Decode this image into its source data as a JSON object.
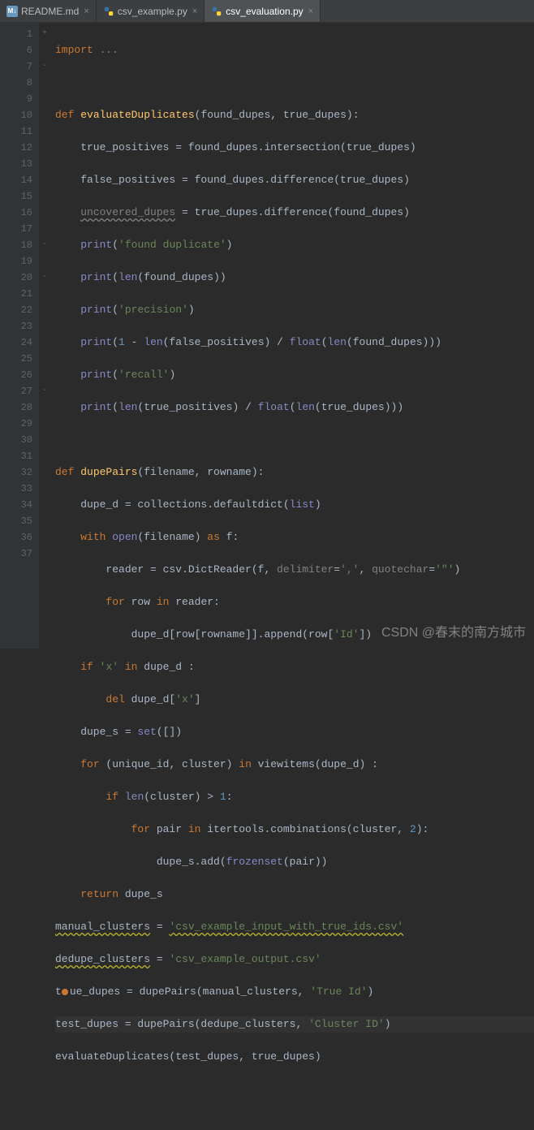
{
  "tabs": [
    {
      "label": "README.md",
      "type": "md",
      "active": false
    },
    {
      "label": "csv_example.py",
      "type": "py",
      "active": false
    },
    {
      "label": "csv_evaluation.py",
      "type": "py",
      "active": true
    }
  ],
  "line_numbers": [
    "1",
    "6",
    "7",
    "8",
    "9",
    "10",
    "11",
    "12",
    "13",
    "14",
    "15",
    "16",
    "17",
    "18",
    "19",
    "20",
    "21",
    "22",
    "23",
    "24",
    "25",
    "26",
    "27",
    "28",
    "29",
    "30",
    "31",
    "32",
    "33",
    "34",
    "35",
    "36",
    "37",
    ""
  ],
  "fold_marks": [
    "+",
    "",
    "-",
    "",
    "",
    "",
    "",
    "",
    "",
    "",
    "",
    "",
    "",
    "-",
    "",
    "-",
    "",
    "",
    "",
    "",
    "",
    "",
    "-",
    "",
    "",
    "",
    "",
    "",
    "",
    "",
    "",
    "",
    "",
    ""
  ],
  "code": {
    "l1": {
      "kw": "import",
      "rest": " ..."
    },
    "l7": {
      "def": "def ",
      "name": "evaluateDuplicates",
      "params": "(found_dupes, true_dupes):"
    },
    "l8": "    true_positives = found_dupes.intersection(true_dupes)",
    "l9": "    false_positives = found_dupes.difference(true_dupes)",
    "l10": {
      "lhs": "    ",
      "var": "uncovered_dupes",
      "rhs": " = true_dupes.difference(found_dupes)"
    },
    "l11": {
      "pre": "    ",
      "fn": "print",
      "open": "(",
      "str": "'found duplicate'",
      "close": ")"
    },
    "l12": {
      "pre": "    ",
      "fn": "print",
      "open": "(",
      "bi": "len",
      "args": "(found_dupes))"
    },
    "l13": {
      "pre": "    ",
      "fn": "print",
      "open": "(",
      "str": "'precision'",
      "close": ")"
    },
    "l14": {
      "pre": "    ",
      "fn": "print",
      "open": "(",
      "one": "1",
      "mid1": " - ",
      "bi1": "len",
      "a1": "(false_positives) / ",
      "bi2": "float",
      "a2": "(",
      "bi3": "len",
      "a3": "(found_dupes)))"
    },
    "l15": {
      "pre": "    ",
      "fn": "print",
      "open": "(",
      "str": "'recall'",
      "close": ")"
    },
    "l16": {
      "pre": "    ",
      "fn": "print",
      "open": "(",
      "bi1": "len",
      "a1": "(true_positives) / ",
      "bi2": "float",
      "a2": "(",
      "bi3": "len",
      "a3": "(true_dupes)))"
    },
    "l18": {
      "def": "def ",
      "name": "dupePairs",
      "params": "(filename, rowname):"
    },
    "l19": {
      "pre": "    dupe_d = collections.defaultdict(",
      "bi": "list",
      "post": ")"
    },
    "l20": {
      "pre": "    ",
      "kw1": "with",
      "mid": " ",
      "bi": "open",
      "args": "(filename) ",
      "kw2": "as",
      "post": " f:"
    },
    "l21": {
      "pre": "        reader = csv.DictReader(f, ",
      "p1": "delimiter",
      "e1": "=",
      "s1": "','",
      "c": ", ",
      "p2": "quotechar",
      "e2": "=",
      "s2": "'\"'",
      "end": ")"
    },
    "l22": {
      "pre": "        ",
      "kw1": "for",
      "m1": " row ",
      "kw2": "in",
      "post": " reader:"
    },
    "l23": {
      "pre": "            dupe_d[row[rowname]].append(row[",
      "str": "'Id'",
      "post": "])"
    },
    "l24": {
      "pre": "    ",
      "kw1": "if",
      "m1": " ",
      "str": "'x'",
      "m2": " ",
      "kw2": "in",
      "post": " dupe_d :"
    },
    "l25": {
      "pre": "        ",
      "kw": "del",
      "mid": " dupe_d[",
      "str": "'x'",
      "post": "]"
    },
    "l26": {
      "pre": "    dupe_s = ",
      "bi": "set",
      "post": "([])"
    },
    "l27": {
      "pre": "    ",
      "kw1": "for",
      "m1": " (unique_id, cluster) ",
      "kw2": "in",
      "m2": " viewitems(dupe_d) :"
    },
    "l28": {
      "pre": "        ",
      "kw": "if",
      "m1": " ",
      "bi": "len",
      "args": "(cluster) > ",
      "num": "1",
      "post": ":"
    },
    "l29": {
      "pre": "            ",
      "kw1": "for",
      "m1": " pair ",
      "kw2": "in",
      "m2": " itertools.combinations(cluster, ",
      "num": "2",
      "post": "):"
    },
    "l30": {
      "pre": "                dupe_s.add(",
      "bi": "frozenset",
      "post": "(pair))"
    },
    "l31": {
      "pre": "    ",
      "kw": "return",
      "post": " dupe_s"
    },
    "l32": {
      "var": "manual_clusters",
      "eq": " = ",
      "str": "'csv_example_input_with_true_ids.csv'"
    },
    "l33": {
      "var": "dedupe_clusters",
      "eq": " = ",
      "str": "'csv_example_output.csv'"
    },
    "l34": {
      "pre1": "t",
      "pre2": "ue_dupes = dupePairs(manual_clusters, ",
      "str": "'True Id'",
      "post": ")"
    },
    "l35": {
      "pre": "test_dupes = dupePairs(dedupe_clusters, ",
      "str": "'Cluster ID'",
      "post": ")"
    },
    "l36": "evaluateDuplicates(test_dupes, true_dupes)"
  },
  "watermark": "CSDN @春末的南方城市"
}
